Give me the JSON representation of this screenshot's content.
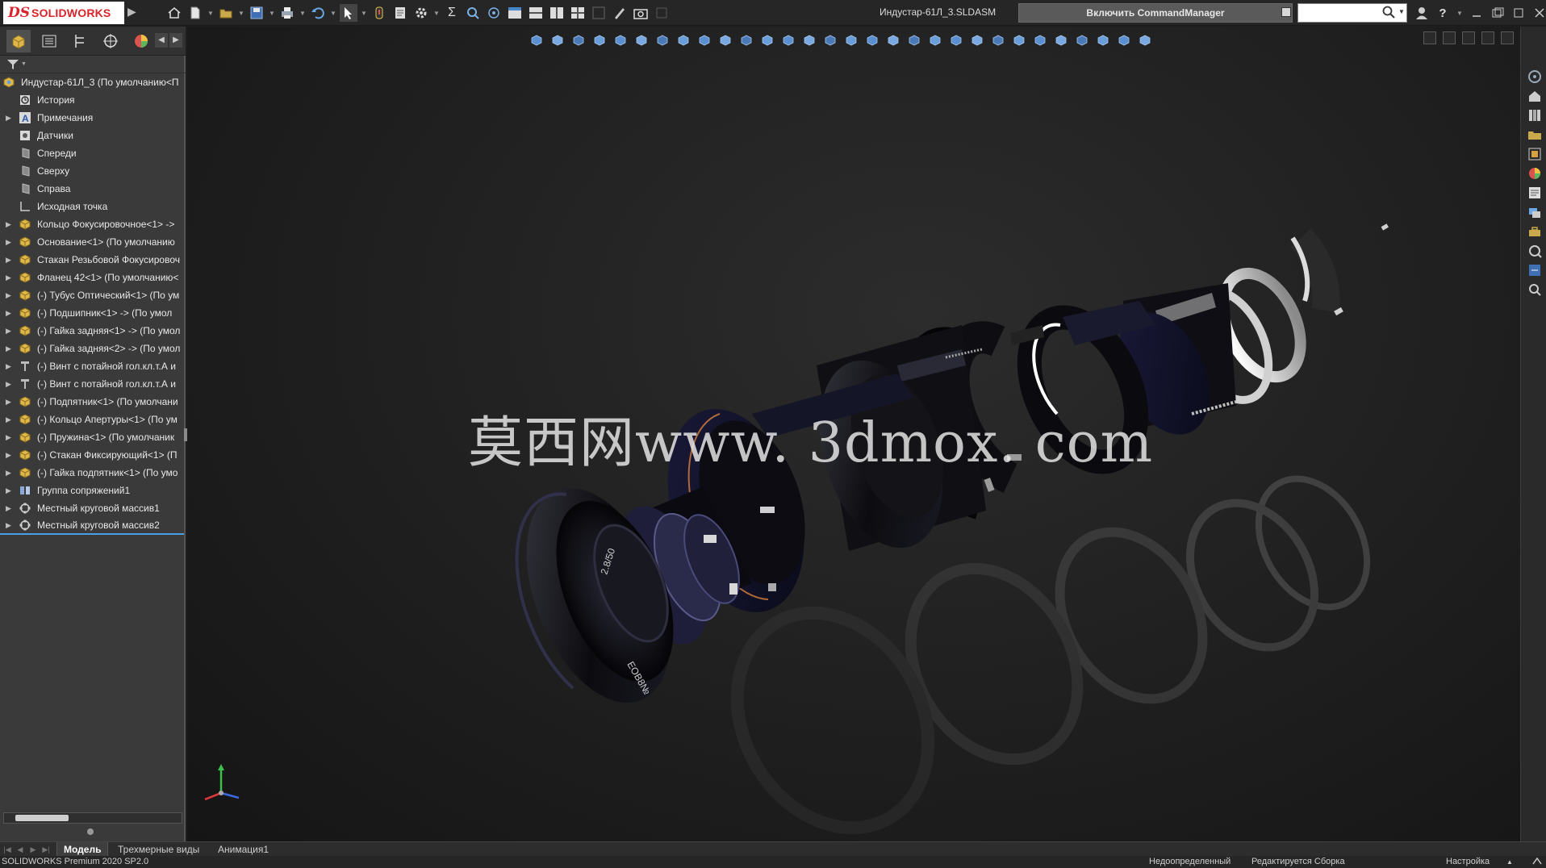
{
  "app": {
    "brand_ds": "DS",
    "brand_name": "SOLIDWORKS",
    "file_title": "Индустар-61Л_3.SLDASM",
    "command_manager_label": "Включить CommandManager",
    "search_placeholder": ""
  },
  "colors": {
    "brand_red": "#d8232a",
    "assembly_icon": "#e0b84a",
    "selection_blue": "#4aa0e6",
    "viewport_bg": "#1f1f1f"
  },
  "quick_toolbar": {
    "icons": [
      "home-icon",
      "new-document-icon",
      "open-icon",
      "save-icon",
      "print-icon",
      "undo-icon",
      "select-icon",
      "rebuild-icon",
      "file-properties-icon",
      "options-icon"
    ]
  },
  "feature_tree": {
    "root": "Индустар-61Л_3  (По умолчанию<П",
    "items": [
      {
        "label": "История",
        "icon": "history-icon",
        "expandable": false
      },
      {
        "label": "Примечания",
        "icon": "annotations-icon",
        "expandable": true
      },
      {
        "label": "Датчики",
        "icon": "sensors-icon",
        "expandable": false
      },
      {
        "label": "Спереди",
        "icon": "plane-icon",
        "expandable": false
      },
      {
        "label": "Сверху",
        "icon": "plane-icon",
        "expandable": false
      },
      {
        "label": "Справа",
        "icon": "plane-icon",
        "expandable": false
      },
      {
        "label": "Исходная точка",
        "icon": "origin-icon",
        "expandable": false
      },
      {
        "label": "Кольцо Фокусировочное<1> ->",
        "icon": "part-icon",
        "expandable": true
      },
      {
        "label": "Основание<1> (По умолчанию",
        "icon": "part-icon",
        "expandable": true
      },
      {
        "label": "Стакан Резьбовой Фокусировоч",
        "icon": "part-icon",
        "expandable": true
      },
      {
        "label": "Фланец 42<1> (По умолчанию<",
        "icon": "part-icon",
        "expandable": true
      },
      {
        "label": "(-) Тубус Оптический<1> (По ум",
        "icon": "part-icon",
        "expandable": true
      },
      {
        "label": "(-) Подшипник<1> -> (По умол",
        "icon": "part-icon",
        "expandable": true
      },
      {
        "label": "(-) Гайка задняя<1> -> (По умол",
        "icon": "part-icon",
        "expandable": true
      },
      {
        "label": "(-) Гайка задняя<2> -> (По умол",
        "icon": "part-icon",
        "expandable": true
      },
      {
        "label": "(-) Винт с потайной гол.кл.т.А и",
        "icon": "screw-icon",
        "expandable": true
      },
      {
        "label": "(-) Винт с потайной гол.кл.т.А и",
        "icon": "screw-icon",
        "expandable": true
      },
      {
        "label": "(-) Подпятник<1> (По умолчани",
        "icon": "part-icon",
        "expandable": true
      },
      {
        "label": "(-) Кольцо Апертуры<1> (По ум",
        "icon": "part-icon",
        "expandable": true
      },
      {
        "label": "(-) Пружина<1> (По умолчаник",
        "icon": "part-icon",
        "expandable": true
      },
      {
        "label": "(-) Стакан Фиксирующий<1> (П",
        "icon": "part-icon",
        "expandable": true
      },
      {
        "label": "(-) Гайка подпятник<1> (По умо",
        "icon": "part-icon",
        "expandable": true
      },
      {
        "label": "Группа сопряжений1",
        "icon": "mates-icon",
        "expandable": true
      },
      {
        "label": "Местный круговой массив1",
        "icon": "circular-pattern-icon",
        "expandable": true
      },
      {
        "label": "Местный круговой массив2",
        "icon": "circular-pattern-icon",
        "expandable": true
      }
    ]
  },
  "viewport": {
    "watermark": "莫西网www. 3dmox. com",
    "lens_engraving_1": "2.8/50",
    "lens_engraving_2": "ЕОВ8№"
  },
  "bottom_tabs": [
    {
      "label": "Модель",
      "active": true
    },
    {
      "label": "Трехмерные виды",
      "active": false
    },
    {
      "label": "Анимация1",
      "active": false
    }
  ],
  "status": {
    "version": "SOLIDWORKS Premium 2020 SP2.0",
    "definition_state": "Недоопределенный",
    "editing_state": "Редактируется Сборка",
    "custom_settings": "Настройка",
    "caret": "▲"
  }
}
